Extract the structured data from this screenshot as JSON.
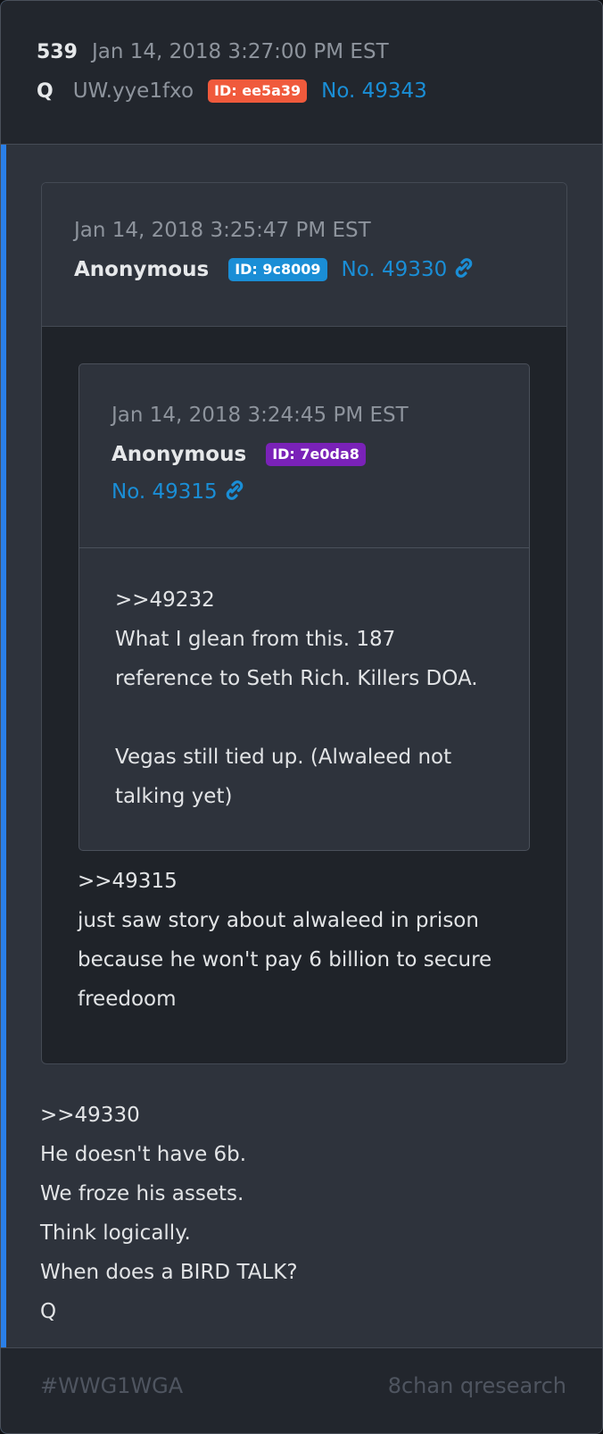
{
  "post": {
    "number": "539",
    "date": "Jan 14, 2018 3:27:00 PM EST",
    "author": "Q",
    "tripcode": "UW.yye1fxo",
    "id_badge": "ID: ee5a39",
    "post_no": "No. 49343",
    "lines": [
      ">>49330",
      "He doesn't have 6b.",
      "We froze his assets.",
      "Think logically.",
      "When does a BIRD TALK?",
      "Q"
    ]
  },
  "quote1": {
    "date": "Jan 14, 2018 3:25:47 PM EST",
    "author": "Anonymous",
    "id_badge": "ID: 9c8009",
    "post_no": "No. 49330",
    "lines": [
      ">>49315",
      "just saw story about alwaleed in prison",
      "because he won't pay 6 billion to secure",
      "freedoom"
    ]
  },
  "quote2": {
    "date": "Jan 14, 2018 3:24:45 PM EST",
    "author": "Anonymous",
    "id_badge": "ID: 7e0da8",
    "post_no": "No. 49315",
    "lines": [
      ">>49232",
      "What I glean from this. 187",
      "reference to Seth Rich. Killers DOA.",
      "",
      "Vegas still tied up.  (Alwaleed not",
      "talking yet)"
    ]
  },
  "footer": {
    "hashtag": "#WWG1WGA",
    "source": "8chan qresearch"
  },
  "colors": {
    "accent_bar": "#2a7fe8",
    "badge_q": "#f05a3c",
    "badge_anon1": "#1a8ed6",
    "badge_anon2": "#7a22b8",
    "link": "#1a8ed6"
  },
  "icons": [
    "link-icon"
  ]
}
